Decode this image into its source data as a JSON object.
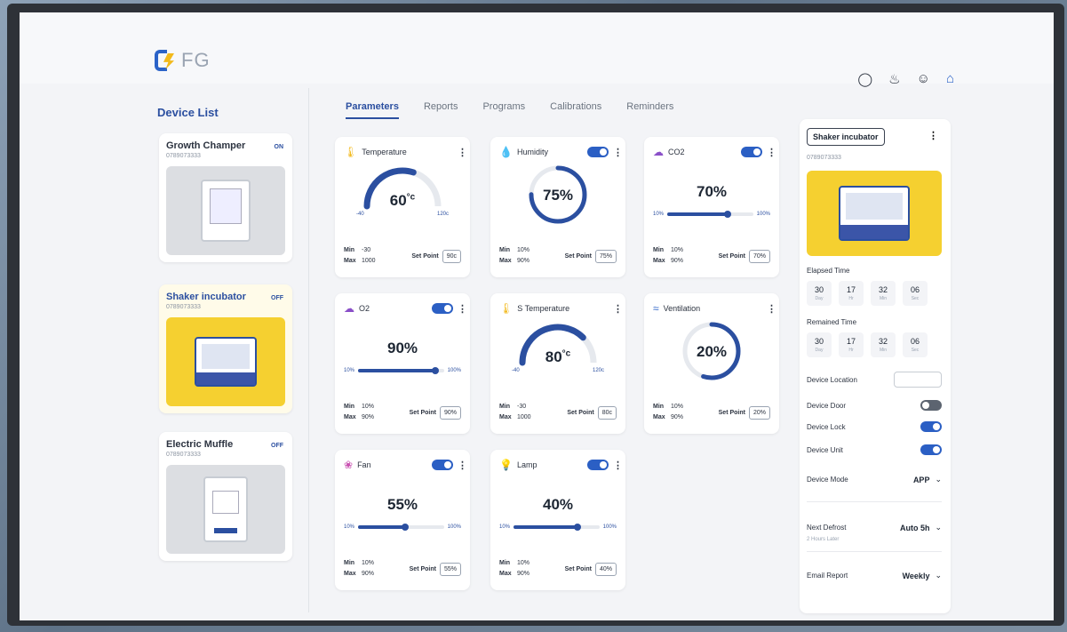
{
  "brand": {
    "logo_text": "FG"
  },
  "top_icons": [
    "tag-icon",
    "bell-icon",
    "user-icon",
    "home-icon"
  ],
  "sidebar": {
    "title": "Device List",
    "devices": [
      {
        "name": "Growth Champer",
        "id": "0789073333",
        "status": "ON"
      },
      {
        "name": "Shaker incubator",
        "id": "0789073333",
        "status": "OFF"
      },
      {
        "name": "Electric Muffle",
        "id": "0789073333",
        "status": "OFF"
      }
    ]
  },
  "tabs": [
    "Parameters",
    "Reports",
    "Programs",
    "Calibrations",
    "Reminders"
  ],
  "params": [
    {
      "title": "Temperature",
      "value": "60",
      "unit": "°c",
      "type": "gauge",
      "fraction": 0.6,
      "range_min": "-40",
      "range_max": "120c",
      "min": "-30",
      "max": "1000",
      "setpoint_label": "Set Point",
      "setpoint": "90c",
      "toggle": null,
      "icon": "thermometer-icon"
    },
    {
      "title": "Humidity",
      "value": "75%",
      "type": "ring",
      "fraction": 0.75,
      "min": "10%",
      "max": "90%",
      "setpoint_label": "Set Point",
      "setpoint": "75%",
      "toggle": true,
      "icon": "droplet-icon"
    },
    {
      "title": "CO2",
      "value": "70%",
      "type": "bar",
      "fraction": 0.7,
      "range_min": "10%",
      "range_max": "100%",
      "min": "10%",
      "max": "90%",
      "setpoint_label": "Set Point",
      "setpoint": "70%",
      "toggle": true,
      "icon": "cloud-icon"
    },
    {
      "title": "O2",
      "value": "90%",
      "type": "bar",
      "fraction": 0.9,
      "range_min": "10%",
      "range_max": "100%",
      "min": "10%",
      "max": "90%",
      "setpoint_label": "Set Point",
      "setpoint": "90%",
      "toggle": true,
      "icon": "cloud-icon"
    },
    {
      "title": "S Temperature",
      "value": "80",
      "unit": "°c",
      "type": "gauge",
      "fraction": 0.75,
      "range_min": "-40",
      "range_max": "120c",
      "min": "-30",
      "max": "1000",
      "setpoint_label": "Set Point",
      "setpoint": "80c",
      "toggle": null,
      "icon": "thermometer-icon"
    },
    {
      "title": "Ventilation",
      "value": "20%",
      "type": "ring",
      "fraction": 0.55,
      "min": "10%",
      "max": "90%",
      "setpoint_label": "Set Point",
      "setpoint": "20%",
      "toggle": null,
      "icon": "wind-icon"
    },
    {
      "title": "Fan",
      "value": "55%",
      "type": "bar",
      "fraction": 0.55,
      "range_min": "10%",
      "range_max": "100%",
      "min": "10%",
      "max": "90%",
      "setpoint_label": "Set Point",
      "setpoint": "55%",
      "toggle": true,
      "icon": "fan-icon"
    },
    {
      "title": "Lamp",
      "value": "40%",
      "type": "bar",
      "fraction": 0.75,
      "range_min": "10%",
      "range_max": "100%",
      "min": "10%",
      "max": "90%",
      "setpoint_label": "Set Point",
      "setpoint": "40%",
      "toggle": true,
      "icon": "bulb-icon"
    }
  ],
  "labels": {
    "min": "Min",
    "max": "Max"
  },
  "panel": {
    "title": "Shaker incubator",
    "id": "0789073333",
    "elapsed_label": "Elapsed Time",
    "elapsed": [
      {
        "v": "30",
        "u": "Day"
      },
      {
        "v": "17",
        "u": "Hr"
      },
      {
        "v": "32",
        "u": "Min"
      },
      {
        "v": "06",
        "u": "Sec"
      }
    ],
    "remained_label": "Remained Time",
    "remained": [
      {
        "v": "30",
        "u": "Day"
      },
      {
        "v": "17",
        "u": "Hr"
      },
      {
        "v": "32",
        "u": "Min"
      },
      {
        "v": "06",
        "u": "Sec"
      }
    ],
    "location_label": "Device Location",
    "door_label": "Device Door",
    "door_on": false,
    "lock_label": "Device Lock",
    "lock_on": true,
    "unit_label": "Device Unit",
    "unit_on": true,
    "mode_label": "Device Mode",
    "mode_value": "APP",
    "defrost_label": "Next Defrost",
    "defrost_sub": "2 Hours Later",
    "defrost_value": "Auto 5h",
    "report_label": "Email Report",
    "report_value": "Weekly"
  }
}
